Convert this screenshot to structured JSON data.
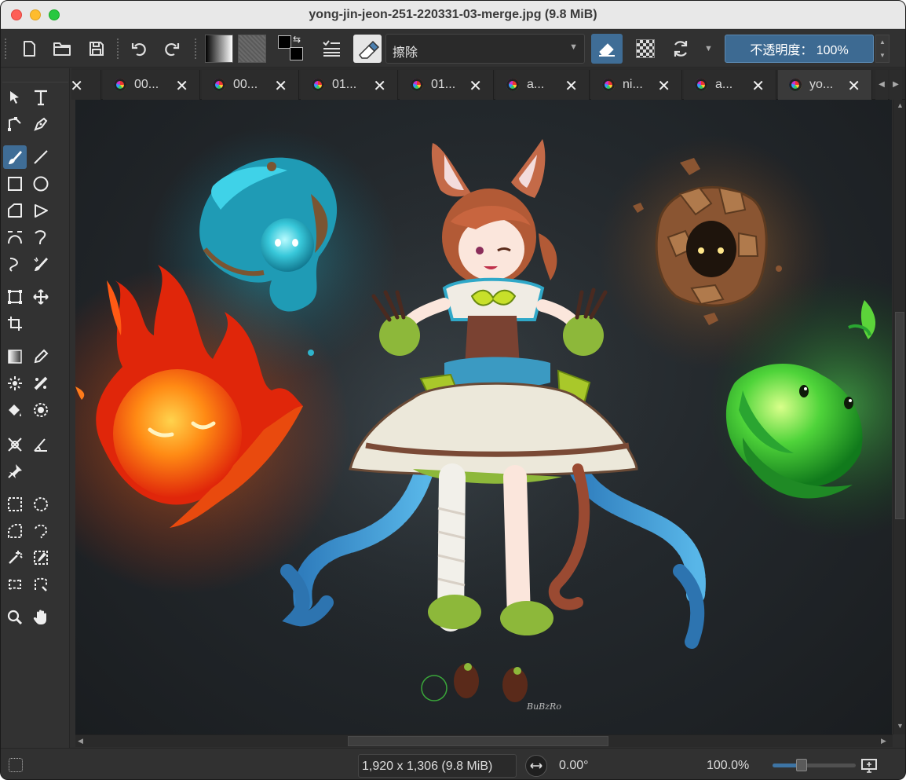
{
  "window": {
    "title": "yong-jin-jeon-251-220331-03-merge.jpg (9.8 MiB)"
  },
  "toolbar": {
    "brush_preset_name": "擦除",
    "opacity_label": "不透明度：  100%",
    "icons": [
      "new-document-icon",
      "open-folder-icon",
      "save-icon",
      "undo-icon",
      "redo-icon",
      "list-icon",
      "eraser-icon",
      "transparency-icon",
      "reload-icon"
    ]
  },
  "tabs": [
    {
      "label": "00..."
    },
    {
      "label": "00..."
    },
    {
      "label": "01..."
    },
    {
      "label": "01..."
    },
    {
      "label": "a..."
    },
    {
      "label": "ni..."
    },
    {
      "label": "a..."
    },
    {
      "label": "yo..."
    }
  ],
  "status": {
    "dimensions": "1,920 x 1,306 (9.8 MiB)",
    "rotation": "0.00°",
    "zoom": "100.0%",
    "zoom_slider_level": 0.34
  },
  "canvas": {
    "signature": "BuBzRo"
  },
  "colors": {
    "accent": "#3f6d96",
    "canvas_bg": "#23282c",
    "fire": "#ff6a1a",
    "water": "#34c4d8",
    "earth": "#a8683c",
    "leaf": "#37c43c"
  }
}
